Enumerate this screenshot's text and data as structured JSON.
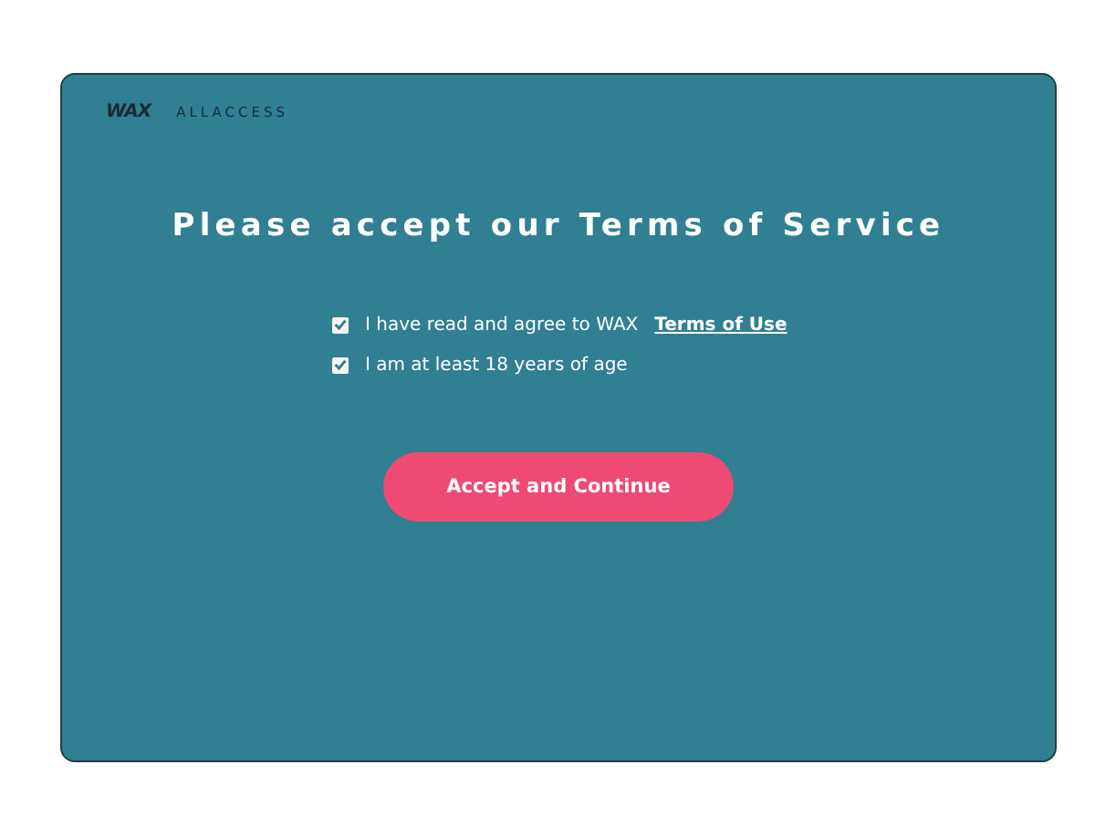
{
  "header": {
    "logo": "WAX",
    "product": "ALLACCESS"
  },
  "title": "Please accept our Terms of Service",
  "agreements": [
    {
      "label": "I have read and agree to WAX",
      "link": "Terms of Use",
      "checked": true
    },
    {
      "label": "I am at least 18 years of age",
      "checked": true
    }
  ],
  "button": "Accept and Continue"
}
